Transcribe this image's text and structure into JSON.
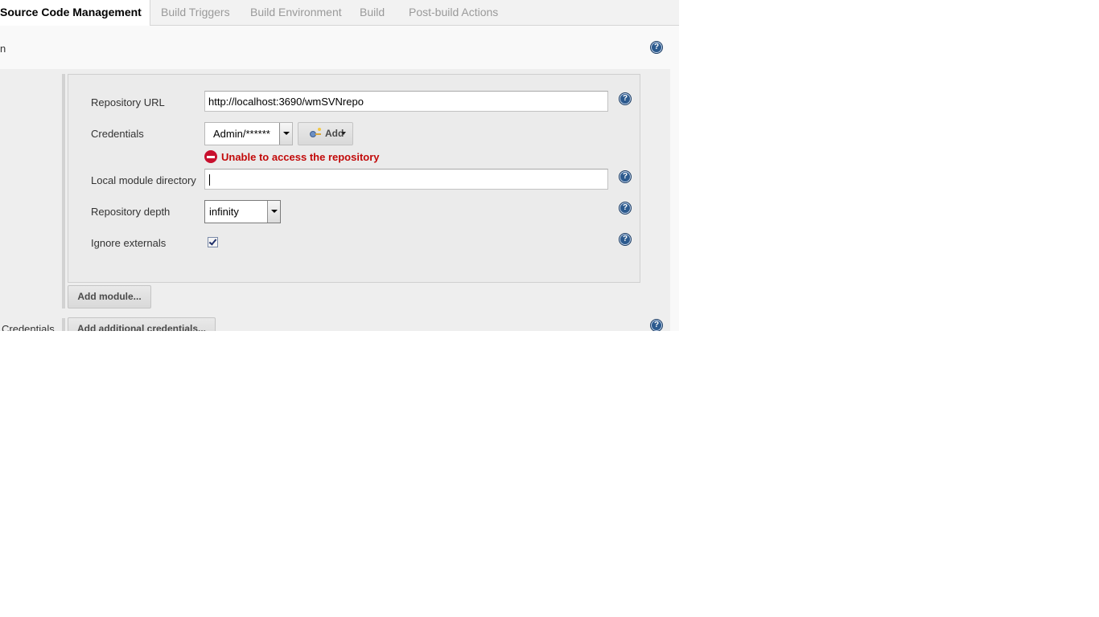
{
  "tabs": [
    {
      "label": "Source Code Management",
      "active": true
    },
    {
      "label": "Build Triggers"
    },
    {
      "label": "Build Environment"
    },
    {
      "label": "Build"
    },
    {
      "label": "Post-build Actions"
    }
  ],
  "section": {
    "cut_label_top": "n",
    "cut_label_bottom": "Credentials"
  },
  "module": {
    "repository_url_label": "Repository URL",
    "repository_url_value": "http://localhost:3690/wmSVNrepo",
    "credentials_label": "Credentials",
    "credentials_selected": "Admin/******",
    "add_button_label": "Add",
    "error_text": "Unable to access the repository",
    "local_module_dir_label": "Local module directory",
    "local_module_dir_value": "",
    "repository_depth_label": "Repository depth",
    "repository_depth_selected": "infinity",
    "ignore_externals_label": "Ignore externals",
    "ignore_externals_checked": true
  },
  "buttons": {
    "add_module": "Add module...",
    "add_additional_credentials": "Add additional credentials..."
  },
  "help_glyph": "?",
  "colors": {
    "error": "#c20a0a",
    "help_icon": "#2c5a8e",
    "panel_bg": "#ebebeb"
  }
}
